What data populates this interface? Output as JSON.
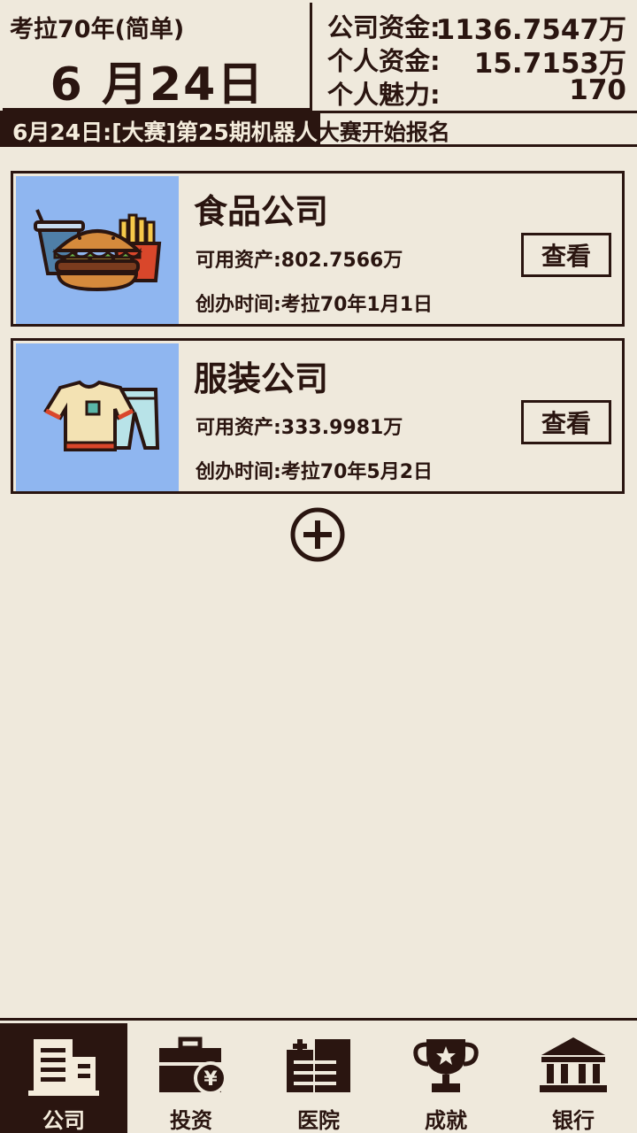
{
  "header": {
    "game_label": "考拉70年(简单)",
    "date_big": "6 月24日",
    "stats": [
      {
        "label": "公司资金:",
        "value": "1136.7547万"
      },
      {
        "label": "个人资金:",
        "value": "15.7153万"
      },
      {
        "label": "个人魅力:",
        "value": "170"
      }
    ]
  },
  "ticker": {
    "date": "6月24日:",
    "middle": "[大赛]第25期机器人",
    "end": "大赛开始报名"
  },
  "companies": [
    {
      "name": "食品公司",
      "assets": "可用资产:802.7566万",
      "founded": "创办时间:考拉70年1月1日",
      "button": "查看",
      "icon": "burger-fries-drink-icon"
    },
    {
      "name": "服装公司",
      "assets": "可用资产:333.9981万",
      "founded": "创办时间:考拉70年5月2日",
      "button": "查看",
      "icon": "shirt-pants-icon"
    }
  ],
  "nav": [
    {
      "label": "公司",
      "icon": "company-building-icon",
      "active": true
    },
    {
      "label": "投资",
      "icon": "briefcase-yen-icon",
      "active": false
    },
    {
      "label": "医院",
      "icon": "hospital-icon",
      "active": false
    },
    {
      "label": "成就",
      "icon": "trophy-icon",
      "active": false
    },
    {
      "label": "银行",
      "icon": "bank-icon",
      "active": false
    }
  ],
  "colors": {
    "background": "#efe9dc",
    "ink": "#2a1510",
    "thumb_blue": "#8fb6f0"
  }
}
